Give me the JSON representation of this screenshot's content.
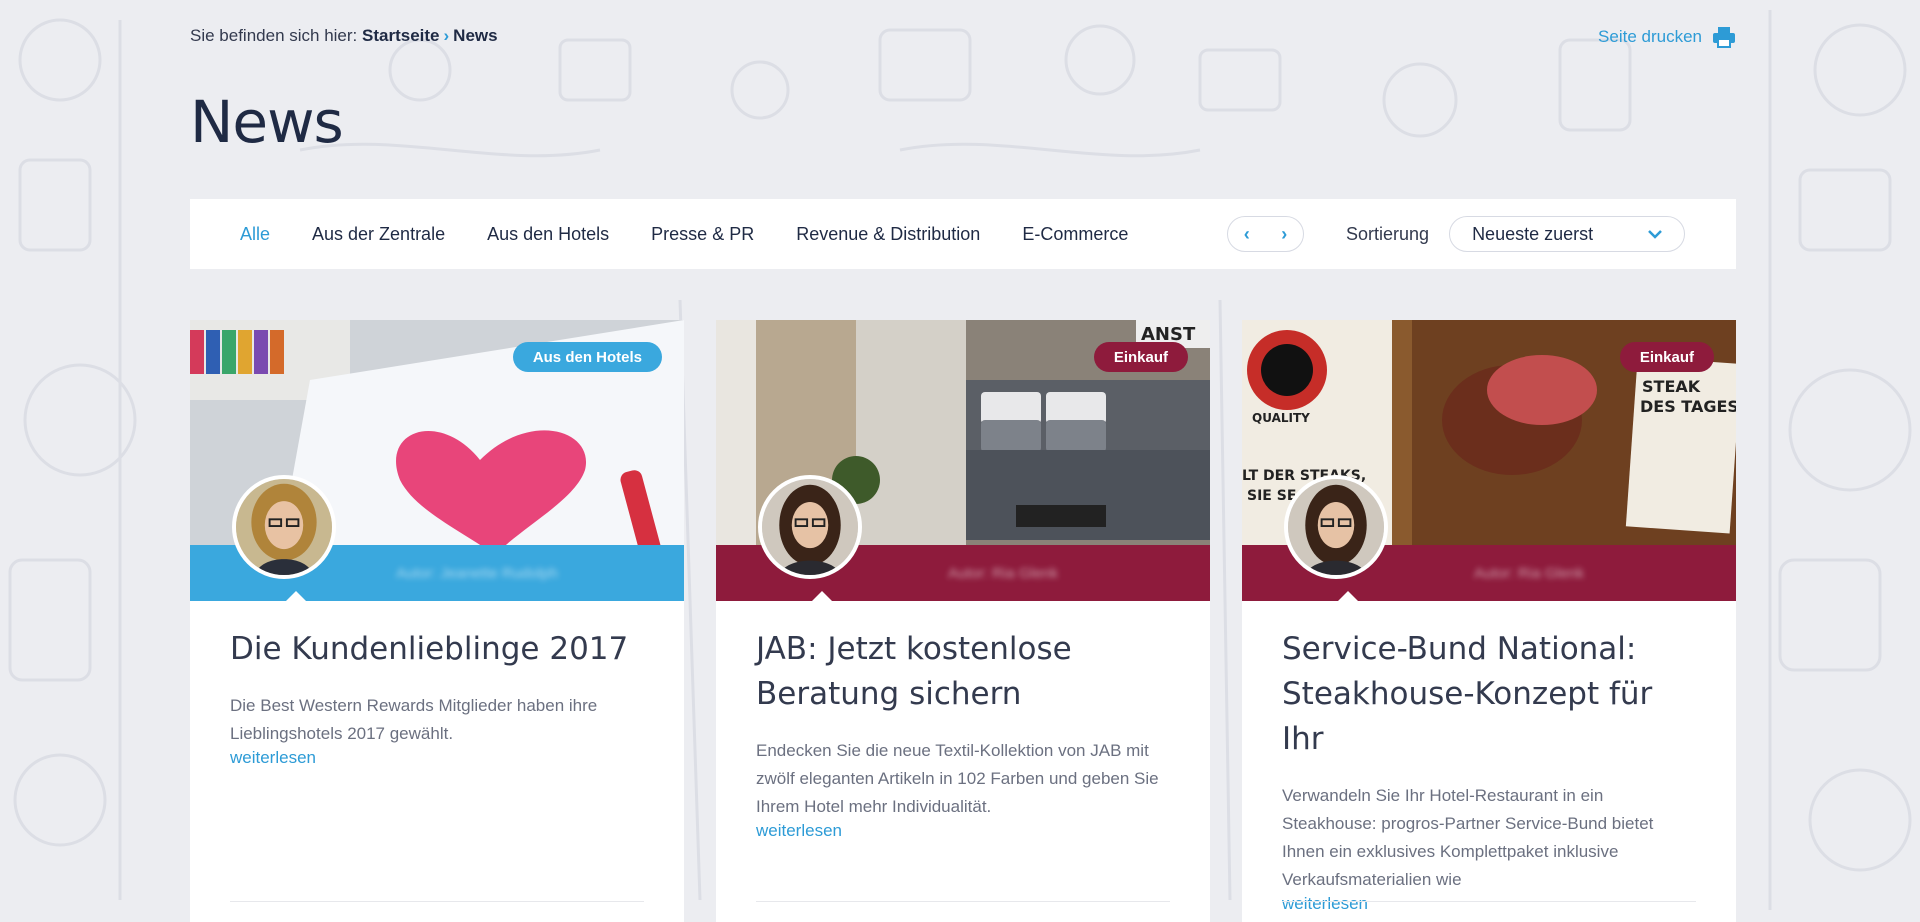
{
  "breadcrumb": {
    "prefix": "Sie befinden sich hier:",
    "home": "Startseite",
    "current": "News"
  },
  "print": {
    "label": "Seite drucken",
    "icon": "printer-icon"
  },
  "page": {
    "title": "News"
  },
  "filters": {
    "tabs": [
      {
        "label": "Alle",
        "active": true
      },
      {
        "label": "Aus der Zentrale"
      },
      {
        "label": "Aus den Hotels"
      },
      {
        "label": "Presse & PR"
      },
      {
        "label": "Revenue & Distribution"
      },
      {
        "label": "E-Commerce"
      }
    ],
    "prev_icon": "chevron-left-icon",
    "next_icon": "chevron-right-icon",
    "sort_label": "Sortierung",
    "sort_value": "Neueste zuerst"
  },
  "colors": {
    "accent": "#2d9bd6",
    "hotels": "#3aa8de",
    "einkauf": "#8e1b3c",
    "title": "#1f2a44"
  },
  "cards": [
    {
      "badge": "Aus den Hotels",
      "title": "Die Kundenlieblinge 2017",
      "text": "Die Best Western Rewards Mitglieder haben ihre Lieblingshotels 2017 gewählt.",
      "read_more": "weiterlesen",
      "author": "Autor: Jeanette Rudolph"
    },
    {
      "badge": "Einkauf",
      "title": "JAB: Jetzt kostenlose Beratung sichern",
      "text": "Endecken Sie die neue Textil-Kollektion von JAB mit zwölf eleganten Artikeln in 102 Farben und geben Sie Ihrem Hotel mehr Individualität.",
      "read_more": "weiterlesen",
      "author": "Autor: Ria Glenk"
    },
    {
      "badge": "Einkauf",
      "title": "Service-Bund National: Steakhouse-Konzept für Ihr",
      "text": "Verwandeln Sie Ihr Hotel-Restaurant in ein Steakhouse: progros-Partner Service-Bund bietet Ihnen ein exklusives Komplettpaket inklusive Verkaufsmaterialien wie",
      "read_more": "weiterlesen",
      "author": "Autor: Ria Glenk"
    }
  ]
}
